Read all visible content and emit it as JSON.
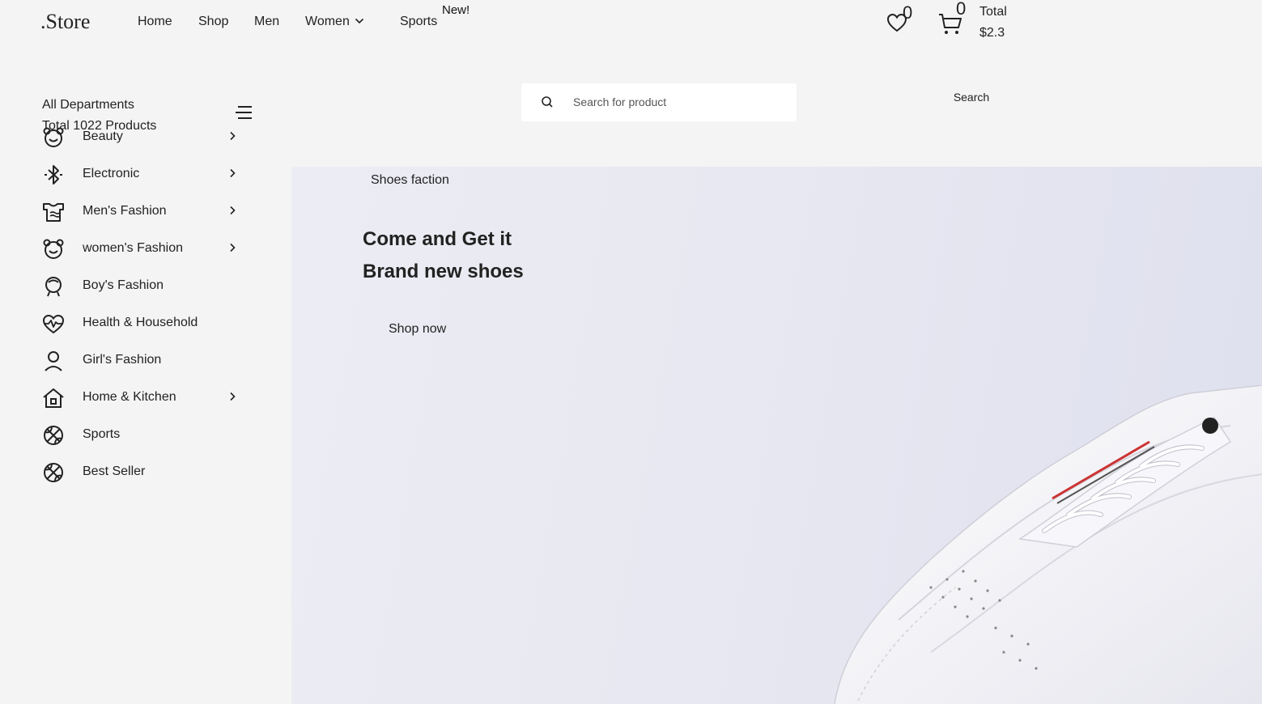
{
  "header": {
    "logo": ".Store",
    "nav": [
      {
        "label": "Home"
      },
      {
        "label": "Shop"
      },
      {
        "label": "Men"
      },
      {
        "label": "Women"
      },
      {
        "label": "Sports"
      }
    ],
    "new_badge": "New!",
    "wishlist_count": "0",
    "cart_count": "0",
    "total_label": "Total",
    "total_amount": "$2.3"
  },
  "sidebar": {
    "title": "All Departments",
    "total": "Total 1022 Products",
    "categories": [
      {
        "label": "Beauty",
        "icon": "bear-face-icon",
        "has_submenu": true
      },
      {
        "label": "Electronic",
        "icon": "bluetooth-icon",
        "has_submenu": true
      },
      {
        "label": "Men's Fashion",
        "icon": "shirt-icon",
        "has_submenu": true
      },
      {
        "label": "women's Fashion",
        "icon": "bear-face-icon",
        "has_submenu": true
      },
      {
        "label": "Boy's Fashion",
        "icon": "boy-face-icon",
        "has_submenu": false
      },
      {
        "label": "Health & Household",
        "icon": "heart-pulse-icon",
        "has_submenu": false
      },
      {
        "label": "Girl's Fashion",
        "icon": "person-icon",
        "has_submenu": false
      },
      {
        "label": "Home & Kitchen",
        "icon": "house-icon",
        "has_submenu": true
      },
      {
        "label": "Sports",
        "icon": "basketball-icon",
        "has_submenu": false
      },
      {
        "label": "Best Seller",
        "icon": "basketball-icon",
        "has_submenu": false
      }
    ]
  },
  "search": {
    "placeholder": "Search for product",
    "value": "",
    "button": "Search"
  },
  "hero": {
    "subtitle": "Shoes faction",
    "headline_line1": "Come and Get it",
    "headline_line2": "Brand new shoes",
    "cta": "Shop now",
    "image": "white-sneaker"
  }
}
